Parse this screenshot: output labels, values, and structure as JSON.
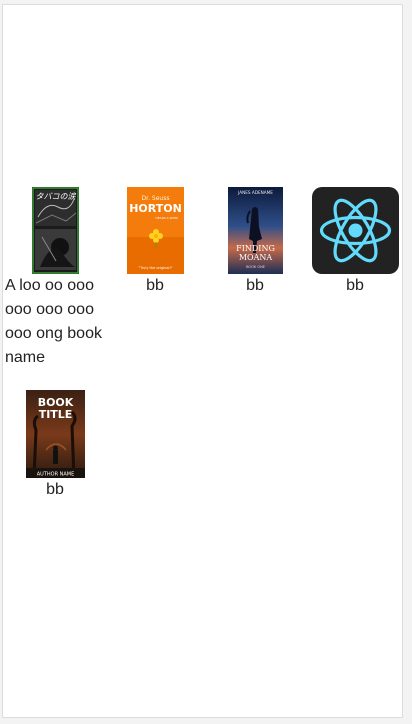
{
  "books": [
    {
      "name": "A loo oo ooo ooo ooo ooo ooo ong book name",
      "cover": "manga-cover",
      "cover_title": "タバコの涙"
    },
    {
      "name": "bb",
      "cover": "horton-cover",
      "cover_title": "Dr. Seuss HORTON"
    },
    {
      "name": "bb",
      "cover": "moana-cover",
      "cover_title": "FINDING MOANA",
      "cover_author": "JANES ADENAME"
    },
    {
      "name": "bb",
      "cover": "react-logo",
      "cover_title": ""
    },
    {
      "name": "bb",
      "cover": "book-title-cover",
      "cover_title": "BOOK TITLE",
      "cover_author": "AUTHOR NAME"
    }
  ],
  "colors": {
    "react_bg": "#222222",
    "react_atom": "#61dafb",
    "horton_bg": "#f47c0d"
  }
}
